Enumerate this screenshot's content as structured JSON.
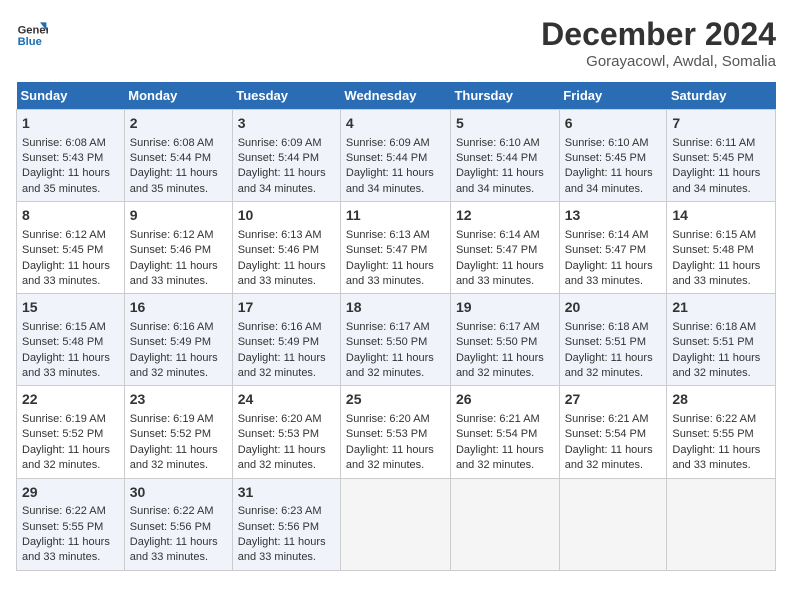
{
  "logo": {
    "line1": "General",
    "line2": "Blue"
  },
  "title": "December 2024",
  "subtitle": "Gorayacowl, Awdal, Somalia",
  "days_of_week": [
    "Sunday",
    "Monday",
    "Tuesday",
    "Wednesday",
    "Thursday",
    "Friday",
    "Saturday"
  ],
  "weeks": [
    [
      {
        "day": "1",
        "sunrise": "6:08 AM",
        "sunset": "5:43 PM",
        "daylight": "11 hours and 35 minutes."
      },
      {
        "day": "2",
        "sunrise": "6:08 AM",
        "sunset": "5:44 PM",
        "daylight": "11 hours and 35 minutes."
      },
      {
        "day": "3",
        "sunrise": "6:09 AM",
        "sunset": "5:44 PM",
        "daylight": "11 hours and 34 minutes."
      },
      {
        "day": "4",
        "sunrise": "6:09 AM",
        "sunset": "5:44 PM",
        "daylight": "11 hours and 34 minutes."
      },
      {
        "day": "5",
        "sunrise": "6:10 AM",
        "sunset": "5:44 PM",
        "daylight": "11 hours and 34 minutes."
      },
      {
        "day": "6",
        "sunrise": "6:10 AM",
        "sunset": "5:45 PM",
        "daylight": "11 hours and 34 minutes."
      },
      {
        "day": "7",
        "sunrise": "6:11 AM",
        "sunset": "5:45 PM",
        "daylight": "11 hours and 34 minutes."
      }
    ],
    [
      {
        "day": "8",
        "sunrise": "6:12 AM",
        "sunset": "5:45 PM",
        "daylight": "11 hours and 33 minutes."
      },
      {
        "day": "9",
        "sunrise": "6:12 AM",
        "sunset": "5:46 PM",
        "daylight": "11 hours and 33 minutes."
      },
      {
        "day": "10",
        "sunrise": "6:13 AM",
        "sunset": "5:46 PM",
        "daylight": "11 hours and 33 minutes."
      },
      {
        "day": "11",
        "sunrise": "6:13 AM",
        "sunset": "5:47 PM",
        "daylight": "11 hours and 33 minutes."
      },
      {
        "day": "12",
        "sunrise": "6:14 AM",
        "sunset": "5:47 PM",
        "daylight": "11 hours and 33 minutes."
      },
      {
        "day": "13",
        "sunrise": "6:14 AM",
        "sunset": "5:47 PM",
        "daylight": "11 hours and 33 minutes."
      },
      {
        "day": "14",
        "sunrise": "6:15 AM",
        "sunset": "5:48 PM",
        "daylight": "11 hours and 33 minutes."
      }
    ],
    [
      {
        "day": "15",
        "sunrise": "6:15 AM",
        "sunset": "5:48 PM",
        "daylight": "11 hours and 33 minutes."
      },
      {
        "day": "16",
        "sunrise": "6:16 AM",
        "sunset": "5:49 PM",
        "daylight": "11 hours and 32 minutes."
      },
      {
        "day": "17",
        "sunrise": "6:16 AM",
        "sunset": "5:49 PM",
        "daylight": "11 hours and 32 minutes."
      },
      {
        "day": "18",
        "sunrise": "6:17 AM",
        "sunset": "5:50 PM",
        "daylight": "11 hours and 32 minutes."
      },
      {
        "day": "19",
        "sunrise": "6:17 AM",
        "sunset": "5:50 PM",
        "daylight": "11 hours and 32 minutes."
      },
      {
        "day": "20",
        "sunrise": "6:18 AM",
        "sunset": "5:51 PM",
        "daylight": "11 hours and 32 minutes."
      },
      {
        "day": "21",
        "sunrise": "6:18 AM",
        "sunset": "5:51 PM",
        "daylight": "11 hours and 32 minutes."
      }
    ],
    [
      {
        "day": "22",
        "sunrise": "6:19 AM",
        "sunset": "5:52 PM",
        "daylight": "11 hours and 32 minutes."
      },
      {
        "day": "23",
        "sunrise": "6:19 AM",
        "sunset": "5:52 PM",
        "daylight": "11 hours and 32 minutes."
      },
      {
        "day": "24",
        "sunrise": "6:20 AM",
        "sunset": "5:53 PM",
        "daylight": "11 hours and 32 minutes."
      },
      {
        "day": "25",
        "sunrise": "6:20 AM",
        "sunset": "5:53 PM",
        "daylight": "11 hours and 32 minutes."
      },
      {
        "day": "26",
        "sunrise": "6:21 AM",
        "sunset": "5:54 PM",
        "daylight": "11 hours and 32 minutes."
      },
      {
        "day": "27",
        "sunrise": "6:21 AM",
        "sunset": "5:54 PM",
        "daylight": "11 hours and 32 minutes."
      },
      {
        "day": "28",
        "sunrise": "6:22 AM",
        "sunset": "5:55 PM",
        "daylight": "11 hours and 33 minutes."
      }
    ],
    [
      {
        "day": "29",
        "sunrise": "6:22 AM",
        "sunset": "5:55 PM",
        "daylight": "11 hours and 33 minutes."
      },
      {
        "day": "30",
        "sunrise": "6:22 AM",
        "sunset": "5:56 PM",
        "daylight": "11 hours and 33 minutes."
      },
      {
        "day": "31",
        "sunrise": "6:23 AM",
        "sunset": "5:56 PM",
        "daylight": "11 hours and 33 minutes."
      },
      null,
      null,
      null,
      null
    ]
  ]
}
